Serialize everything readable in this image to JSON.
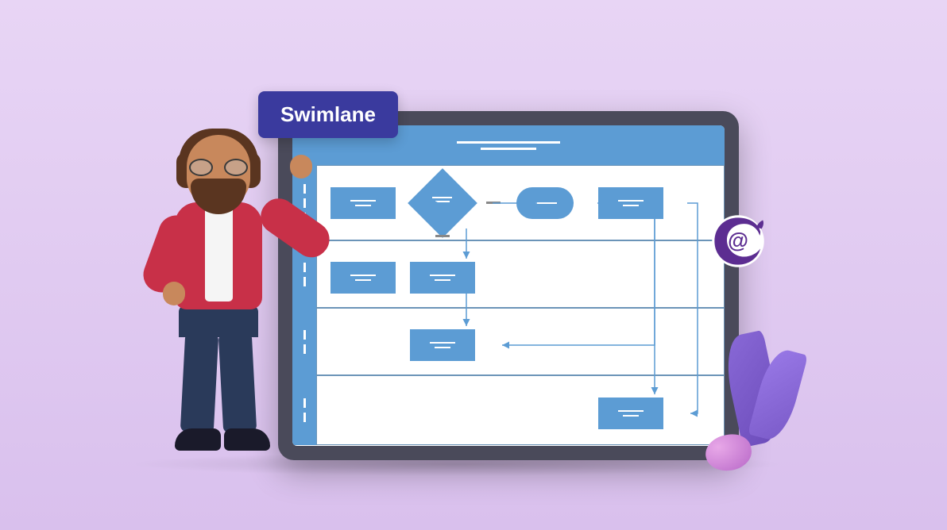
{
  "title": "Swimlane",
  "blazor_icon": "@",
  "colors": {
    "badge_bg": "#3a3a9e",
    "shape_fill": "#5c9cd4",
    "tablet_frame": "#4a4a5a",
    "jacket": "#c83048",
    "blazor_purple": "#5c2d91"
  },
  "diagram": {
    "lanes": 4,
    "shapes": [
      {
        "id": "n1",
        "type": "process",
        "lane": 1
      },
      {
        "id": "decision",
        "type": "decision",
        "lane": 1
      },
      {
        "id": "terminator",
        "type": "terminator",
        "lane": 1
      },
      {
        "id": "n4",
        "type": "process",
        "lane": 1
      },
      {
        "id": "n5",
        "type": "process",
        "lane": 2
      },
      {
        "id": "n6",
        "type": "process",
        "lane": 2
      },
      {
        "id": "n7",
        "type": "process",
        "lane": 3
      },
      {
        "id": "n8",
        "type": "process",
        "lane": 4
      }
    ],
    "connectors": [
      {
        "from": "n1",
        "to": "decision"
      },
      {
        "from": "decision",
        "to": "terminator"
      },
      {
        "from": "terminator",
        "to": "n4"
      },
      {
        "from": "decision",
        "to": "n6"
      },
      {
        "from": "n6",
        "to": "n7"
      },
      {
        "from": "n4",
        "to": "n7"
      },
      {
        "from": "n4",
        "to": "n8"
      }
    ]
  }
}
